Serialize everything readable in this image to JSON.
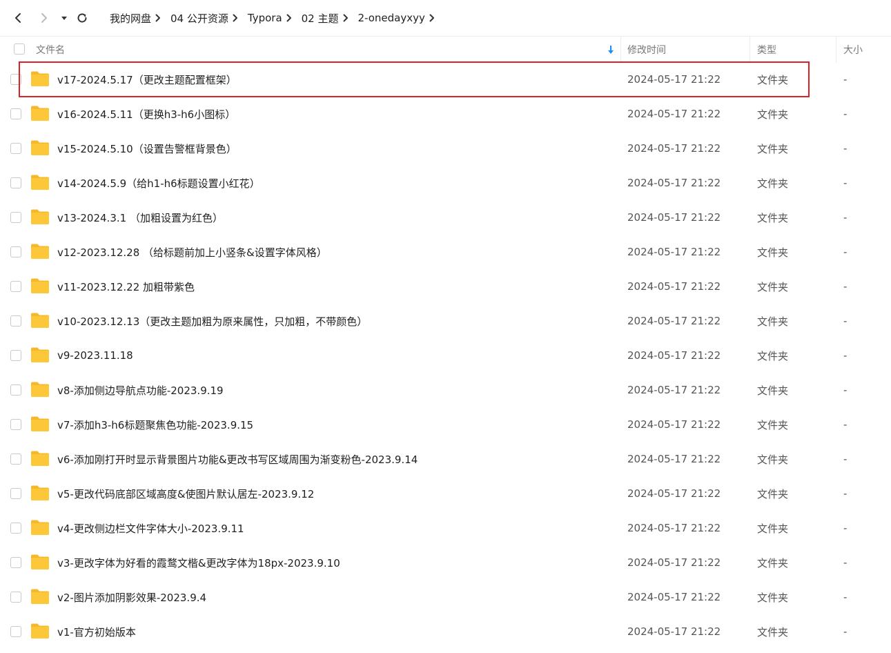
{
  "toolbar": {
    "back_icon": "chevron-left-icon",
    "forward_icon": "chevron-right-icon",
    "dropdown_icon": "caret-down-icon",
    "refresh_icon": "refresh-icon"
  },
  "breadcrumbs": [
    "我的网盘",
    "04 公开资源",
    "Typora",
    "02 主题",
    "2-onedayxyy"
  ],
  "header": {
    "name": "文件名",
    "modified": "修改时间",
    "type": "类型",
    "size": "大小",
    "sort_icon": "sort-down-arrow-icon"
  },
  "colors": {
    "folder": "#FDC73A",
    "sort_arrow": "#1A8CFF",
    "highlight_border": "#E01E25"
  },
  "files": [
    {
      "name": "v17-2024.5.17（更改主题配置框架）",
      "modified": "2024-05-17 21:22",
      "type": "文件夹",
      "size": "-"
    },
    {
      "name": "v16-2024.5.11（更换h3-h6小图标）",
      "modified": "2024-05-17 21:22",
      "type": "文件夹",
      "size": "-"
    },
    {
      "name": "v15-2024.5.10（设置告警框背景色）",
      "modified": "2024-05-17 21:22",
      "type": "文件夹",
      "size": "-"
    },
    {
      "name": "v14-2024.5.9（给h1-h6标题设置小红花）",
      "modified": "2024-05-17 21:22",
      "type": "文件夹",
      "size": "-"
    },
    {
      "name": "v13-2024.3.1 （加粗设置为红色）",
      "modified": "2024-05-17 21:22",
      "type": "文件夹",
      "size": "-"
    },
    {
      "name": "v12-2023.12.28 （给标题前加上小竖条&设置字体风格）",
      "modified": "2024-05-17 21:22",
      "type": "文件夹",
      "size": "-"
    },
    {
      "name": "v11-2023.12.22 加粗带紫色",
      "modified": "2024-05-17 21:22",
      "type": "文件夹",
      "size": "-"
    },
    {
      "name": "v10-2023.12.13（更改主题加粗为原来属性，只加粗，不带颜色）",
      "modified": "2024-05-17 21:22",
      "type": "文件夹",
      "size": "-"
    },
    {
      "name": "v9-2023.11.18",
      "modified": "2024-05-17 21:22",
      "type": "文件夹",
      "size": "-"
    },
    {
      "name": "v8-添加侧边导航点功能-2023.9.19",
      "modified": "2024-05-17 21:22",
      "type": "文件夹",
      "size": "-"
    },
    {
      "name": "v7-添加h3-h6标题聚焦色功能-2023.9.15",
      "modified": "2024-05-17 21:22",
      "type": "文件夹",
      "size": "-"
    },
    {
      "name": "v6-添加刚打开时显示背景图片功能&更改书写区域周围为渐变粉色-2023.9.14",
      "modified": "2024-05-17 21:22",
      "type": "文件夹",
      "size": "-"
    },
    {
      "name": "v5-更改代码底部区域高度&使图片默认居左-2023.9.12",
      "modified": "2024-05-17 21:22",
      "type": "文件夹",
      "size": "-"
    },
    {
      "name": "v4-更改侧边栏文件字体大小-2023.9.11",
      "modified": "2024-05-17 21:22",
      "type": "文件夹",
      "size": "-"
    },
    {
      "name": "v3-更改字体为好看的霞鹜文楷&更改字体为18px-2023.9.10",
      "modified": "2024-05-17 21:22",
      "type": "文件夹",
      "size": "-"
    },
    {
      "name": "v2-图片添加阴影效果-2023.9.4",
      "modified": "2024-05-17 21:22",
      "type": "文件夹",
      "size": "-"
    },
    {
      "name": "v1-官方初始版本",
      "modified": "2024-05-17 21:22",
      "type": "文件夹",
      "size": "-"
    }
  ]
}
